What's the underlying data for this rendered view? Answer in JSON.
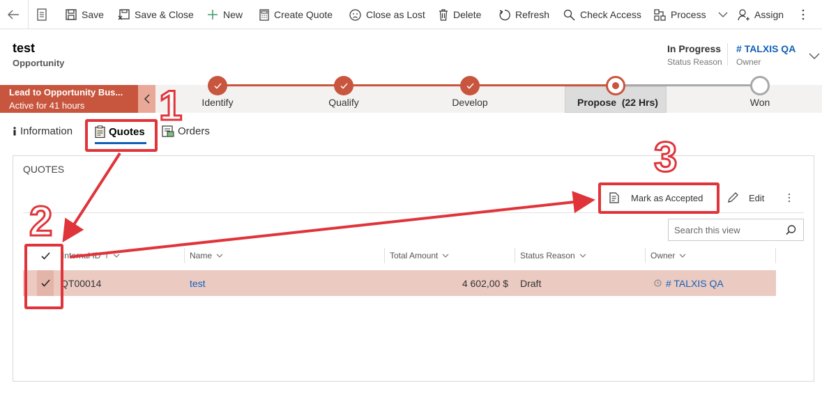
{
  "commands": {
    "save": "Save",
    "save_close": "Save & Close",
    "new": "New",
    "create_quote": "Create Quote",
    "close_lost": "Close as Lost",
    "delete": "Delete",
    "refresh": "Refresh",
    "check_access": "Check Access",
    "process": "Process",
    "assign": "Assign"
  },
  "record": {
    "title": "test",
    "entity": "Opportunity",
    "status_value": "In Progress",
    "status_label": "Status Reason",
    "owner_value": "# TALXIS QA",
    "owner_label": "Owner"
  },
  "bpf": {
    "process_name": "Lead to Opportunity Bus...",
    "process_status": "Active for 41 hours",
    "stages": [
      {
        "label": "Identify",
        "state": "done"
      },
      {
        "label": "Qualify",
        "state": "done"
      },
      {
        "label": "Develop",
        "state": "done"
      },
      {
        "label": "Propose  (22 Hrs)",
        "state": "active"
      },
      {
        "label": "Won",
        "state": "todo"
      }
    ],
    "accent_color": "#c8553d"
  },
  "tabs": [
    {
      "label": "Information",
      "icon": "info-icon"
    },
    {
      "label": "Quotes",
      "icon": "clipboard-icon",
      "active": true
    },
    {
      "label": "Orders",
      "icon": "order-icon"
    }
  ],
  "quotes": {
    "section_title": "QUOTES",
    "mark_accepted": "Mark as Accepted",
    "edit": "Edit",
    "search_placeholder": "Search this view",
    "columns": [
      "Internal ID",
      "Name",
      "Total Amount",
      "Status Reason",
      "Owner"
    ],
    "rows": [
      {
        "id": "QT00014",
        "name": "test",
        "amount": "4 602,00 $",
        "status": "Draft",
        "owner": "# TALXIS QA"
      }
    ]
  },
  "annotations": {
    "one": "1",
    "two": "2",
    "three": "3",
    "color": "#e0343b"
  }
}
